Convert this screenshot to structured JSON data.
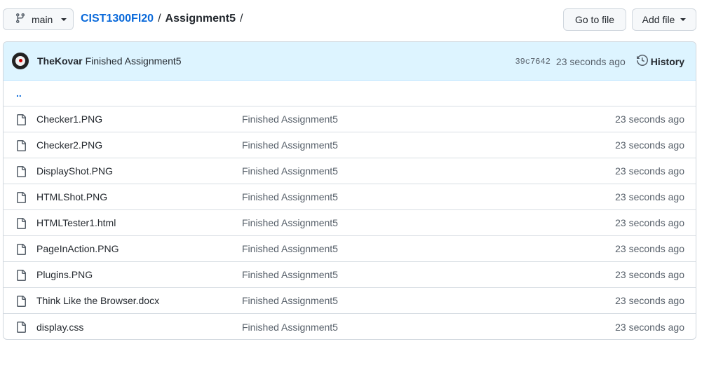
{
  "branch": {
    "name": "main",
    "icon": "git-branch-icon"
  },
  "breadcrumb": {
    "repo": "CIST1300Fl20",
    "separator": "/",
    "folder": "Assignment5",
    "trailing": "/"
  },
  "actions": {
    "go_to_file": "Go to file",
    "add_file": "Add file"
  },
  "commit": {
    "author": "TheKovar",
    "message": "Finished Assignment5",
    "sha": "39c7642",
    "time": "23 seconds ago",
    "history_label": "History"
  },
  "parent_link": "..",
  "files": [
    {
      "name": "Checker1.PNG",
      "message": "Finished Assignment5",
      "age": "23 seconds ago"
    },
    {
      "name": "Checker2.PNG",
      "message": "Finished Assignment5",
      "age": "23 seconds ago"
    },
    {
      "name": "DisplayShot.PNG",
      "message": "Finished Assignment5",
      "age": "23 seconds ago"
    },
    {
      "name": "HTMLShot.PNG",
      "message": "Finished Assignment5",
      "age": "23 seconds ago"
    },
    {
      "name": "HTMLTester1.html",
      "message": "Finished Assignment5",
      "age": "23 seconds ago"
    },
    {
      "name": "PageInAction.PNG",
      "message": "Finished Assignment5",
      "age": "23 seconds ago"
    },
    {
      "name": "Plugins.PNG",
      "message": "Finished Assignment5",
      "age": "23 seconds ago"
    },
    {
      "name": "Think Like the Browser.docx",
      "message": "Finished Assignment5",
      "age": "23 seconds ago"
    },
    {
      "name": "display.css",
      "message": "Finished Assignment5",
      "age": "23 seconds ago"
    }
  ],
  "colors": {
    "link": "#0969da",
    "commit_bar": "#ddf4ff",
    "border": "#d0d7de",
    "muted": "#57606a"
  }
}
